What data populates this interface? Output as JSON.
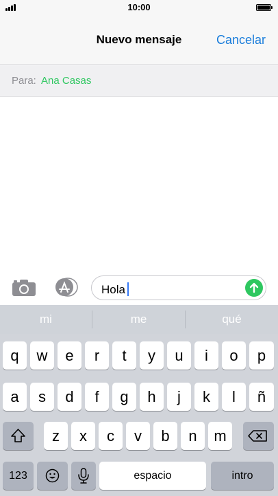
{
  "status_bar": {
    "time": "10:00"
  },
  "nav": {
    "title": "Nuevo mensaje",
    "cancel_label": "Cancelar"
  },
  "recipient": {
    "label": "Para:",
    "name": "Ana Casas"
  },
  "composer": {
    "text": "Hola"
  },
  "predictions": [
    "mi",
    "me",
    "qué"
  ],
  "keyboard": {
    "row1": [
      "q",
      "w",
      "e",
      "r",
      "t",
      "y",
      "u",
      "i",
      "o",
      "p"
    ],
    "row2": [
      "a",
      "s",
      "d",
      "f",
      "g",
      "h",
      "j",
      "k",
      "l",
      "ñ"
    ],
    "row3": [
      "z",
      "x",
      "c",
      "v",
      "b",
      "n",
      "m"
    ],
    "numbers_label": "123",
    "space_label": "espacio",
    "return_label": "intro"
  },
  "icons": {
    "camera": "camera-icon",
    "apps": "app-store-icon",
    "send": "arrow-up-icon",
    "shift": "shift-icon",
    "delete": "backspace-icon",
    "emoji": "emoji-icon",
    "mic": "microphone-icon"
  },
  "colors": {
    "accent_blue": "#1a7ddb",
    "imessage_green": "#2ec760"
  }
}
